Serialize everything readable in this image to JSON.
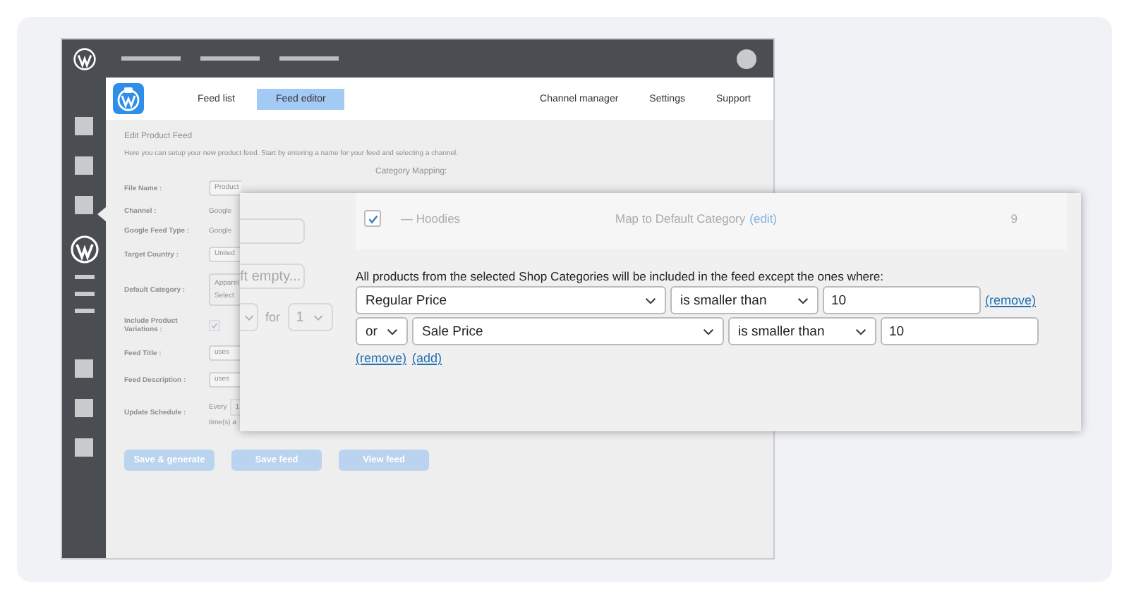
{
  "nav": {
    "tabs": [
      {
        "label": "Feed list",
        "selected": false
      },
      {
        "label": "Feed editor",
        "selected": true
      }
    ],
    "links": [
      "Channel manager",
      "Settings",
      "Support"
    ]
  },
  "page": {
    "title": "Edit Product Feed",
    "description": "Here you can setup your new product feed. Start by entering a name for your feed and selecting a channel.",
    "category_mapping_label": "Category Mapping:",
    "fields": [
      {
        "label": "File Name :",
        "kind": "input",
        "values": [
          "Product"
        ]
      },
      {
        "label": "Channel :",
        "kind": "text",
        "values": [
          "Google"
        ]
      },
      {
        "label": "Google Feed Type :",
        "kind": "text",
        "values": [
          "Google"
        ]
      },
      {
        "label": "Target Country :",
        "kind": "input",
        "values": [
          "United"
        ]
      },
      {
        "label": "Default Category :",
        "kind": "double",
        "values": [
          "Apparel",
          "Select"
        ]
      },
      {
        "label": "Include Product Variations :",
        "kind": "checkbox",
        "checked": true
      },
      {
        "label": "Feed Title :",
        "kind": "input",
        "values": [
          "uses"
        ]
      },
      {
        "label": "Feed Description :",
        "kind": "input",
        "values": [
          "uses"
        ]
      },
      {
        "label": "Update Schedule :",
        "kind": "schedule",
        "values": [
          "Every",
          "1",
          "time(s) a"
        ]
      }
    ],
    "buttons": [
      "Save & generate",
      "Save feed",
      "View feed"
    ]
  },
  "popup": {
    "left": {
      "placeholder_fragment": "ft empty...",
      "for_label": "for",
      "count_value": "1"
    },
    "mapping_rows": [
      {
        "checked": true,
        "name": "— Hoodies",
        "mapping": "Map to Default Category",
        "edit": "(edit)",
        "count": "9"
      }
    ],
    "intro": "All products from the selected Shop Categories will be included in the feed except the ones where:",
    "rules": [
      {
        "field": "Regular Price",
        "operator": "is smaller than",
        "value": "10",
        "remove": "(remove)"
      },
      {
        "connector": "or",
        "field": "Sale Price",
        "operator": "is smaller than",
        "value": "10"
      }
    ],
    "actions": [
      "(remove)",
      "(add)"
    ]
  }
}
